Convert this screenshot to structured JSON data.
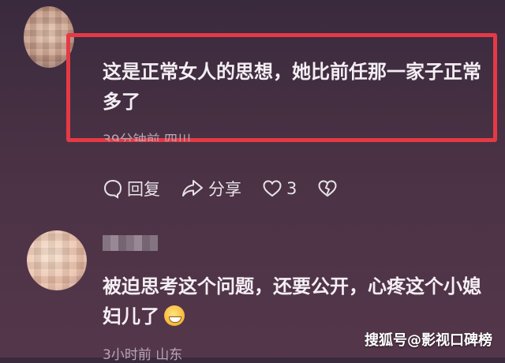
{
  "comments": [
    {
      "text": "这是正常女人的思想，她比前任那一家子正常多了",
      "meta": "39分钟前 四川",
      "actions": {
        "reply": "回复",
        "share": "分享",
        "likes": "3"
      }
    },
    {
      "text": "被迫思考这个问题，还要公开，心疼这个小媳妇儿了",
      "meta": "3小时前 山东"
    }
  ],
  "watermark": "搜狐号@影视口碑榜",
  "colors": {
    "highlight": "#e53a46",
    "background": "#4a3244"
  },
  "icons": [
    "reply-icon",
    "share-icon",
    "like-icon",
    "dislike-icon",
    "grin-sweat-emoji"
  ]
}
